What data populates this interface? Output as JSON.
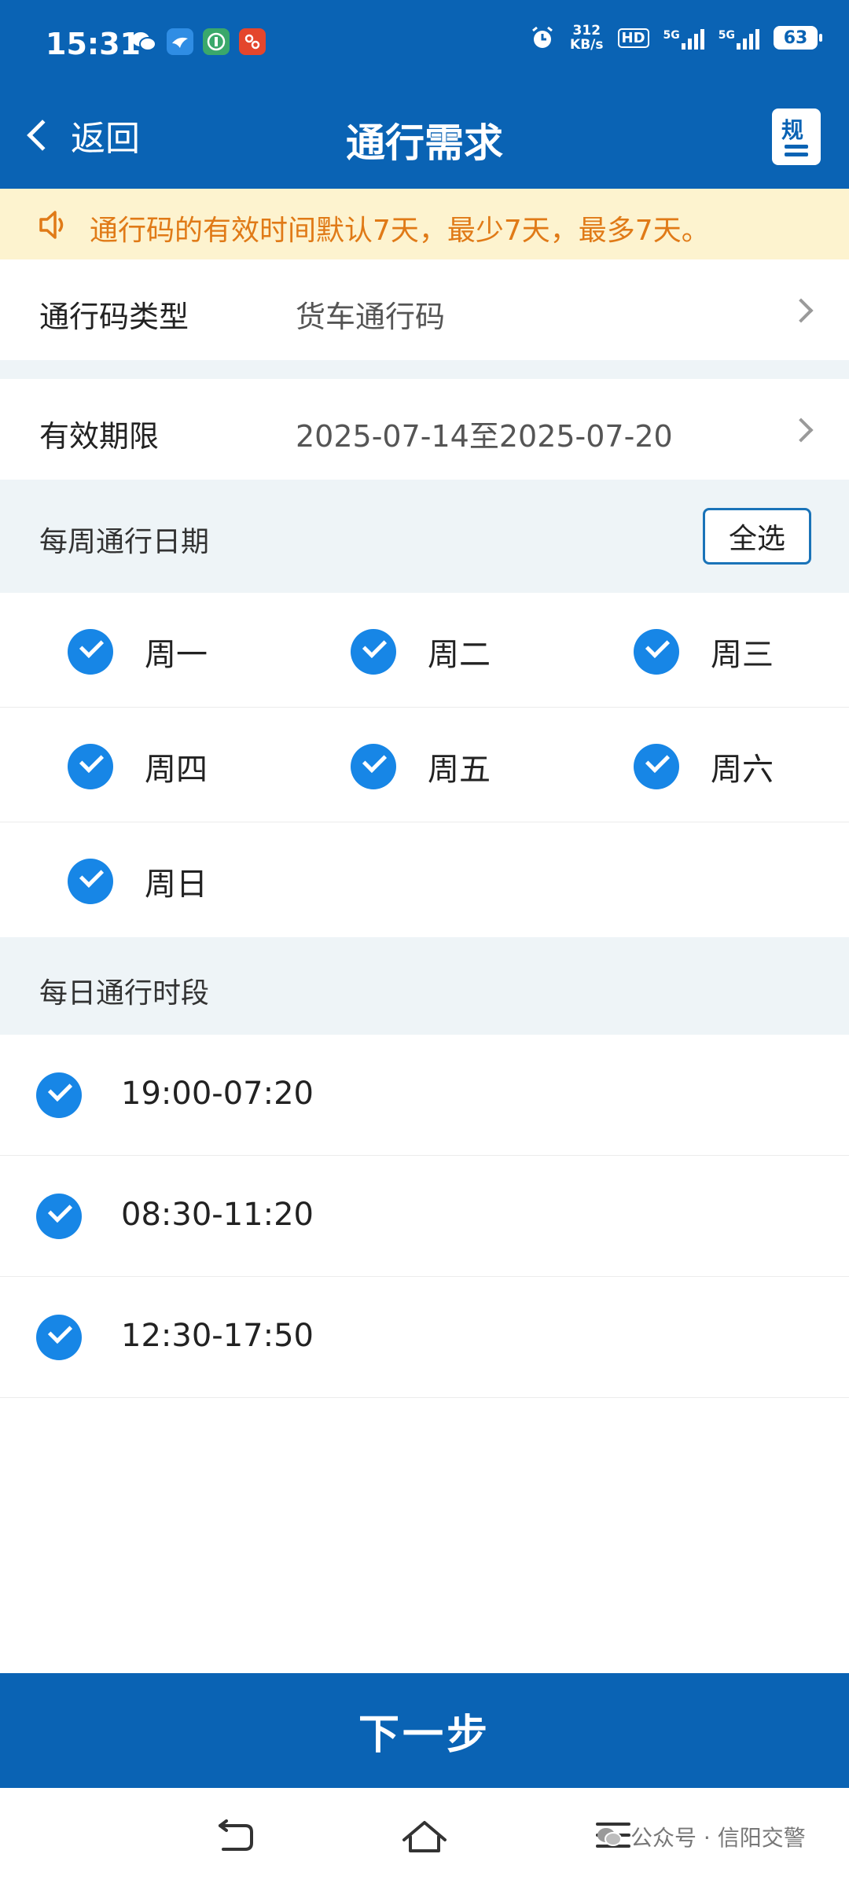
{
  "status_bar": {
    "time": "15:31",
    "net_speed_value": "312",
    "net_speed_unit": "KB/s",
    "hd_label": "HD",
    "sig1_label": "5G",
    "sig2_label": "5G",
    "battery": "63"
  },
  "nav": {
    "back_label": "返回",
    "title": "通行需求",
    "rules_icon_char": "规"
  },
  "notice": {
    "text": "通行码的有效时间默认7天，最少7天，最多7天。"
  },
  "pass_type": {
    "label": "通行码类型",
    "value": "货车通行码"
  },
  "validity": {
    "label": "有效期限",
    "value": "2025-07-14至2025-07-20"
  },
  "weekly": {
    "label": "每周通行日期",
    "select_all": "全选",
    "days": [
      {
        "label": "周一",
        "checked": true
      },
      {
        "label": "周二",
        "checked": true
      },
      {
        "label": "周三",
        "checked": true
      },
      {
        "label": "周四",
        "checked": true
      },
      {
        "label": "周五",
        "checked": true
      },
      {
        "label": "周六",
        "checked": true
      },
      {
        "label": "周日",
        "checked": true
      }
    ]
  },
  "daily": {
    "label": "每日通行时段",
    "slots": [
      {
        "label": "19:00-07:20",
        "checked": true
      },
      {
        "label": "08:30-11:20",
        "checked": true
      },
      {
        "label": "12:30-17:50",
        "checked": true
      }
    ]
  },
  "next_button": "下一步",
  "watermark": "公众号 · 信阳交警",
  "colors": {
    "primary": "#0a63b4",
    "check": "#1786e6",
    "notice_bg": "#fdf3cf",
    "notice_text": "#e07a17",
    "section_bg": "#eef4f7"
  }
}
